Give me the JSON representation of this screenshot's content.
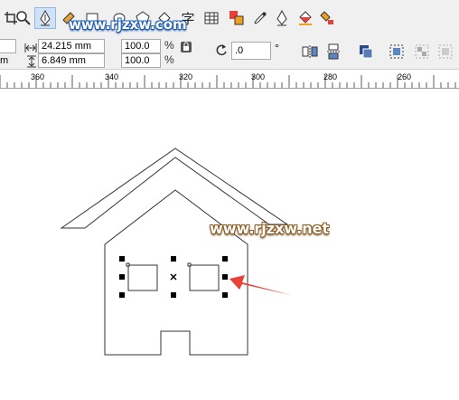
{
  "toolbar": {
    "tools": [
      {
        "name": "crop-icon"
      },
      {
        "name": "zoom-icon"
      },
      {
        "name": "pen-icon"
      },
      {
        "name": "fill-icon"
      },
      {
        "name": "rectangle-icon"
      },
      {
        "name": "ellipse-icon"
      },
      {
        "name": "polygon-icon"
      },
      {
        "name": "text-icon",
        "glyph": "字"
      },
      {
        "name": "table-icon"
      },
      {
        "name": "effects-icon"
      },
      {
        "name": "eyedropper-icon"
      },
      {
        "name": "outline-pen-icon"
      },
      {
        "name": "paint-bucket-icon"
      },
      {
        "name": "interactive-fill-icon"
      }
    ],
    "watermark": "www.rjzxw.com"
  },
  "properties": {
    "width_value": "24.215 mm",
    "height_value": "6.849 mm",
    "x_unit_fragment": "m",
    "scale_x": "100.0",
    "scale_y": "100.0",
    "percent_symbol": "%",
    "rotation": ".0",
    "degree_symbol": "°"
  },
  "ruler": {
    "labels": [
      "360",
      "340",
      "320",
      "300",
      "280",
      "260"
    ]
  },
  "canvas": {
    "watermark": "www.rjzxw.net",
    "accent_color": "#e8413a"
  }
}
